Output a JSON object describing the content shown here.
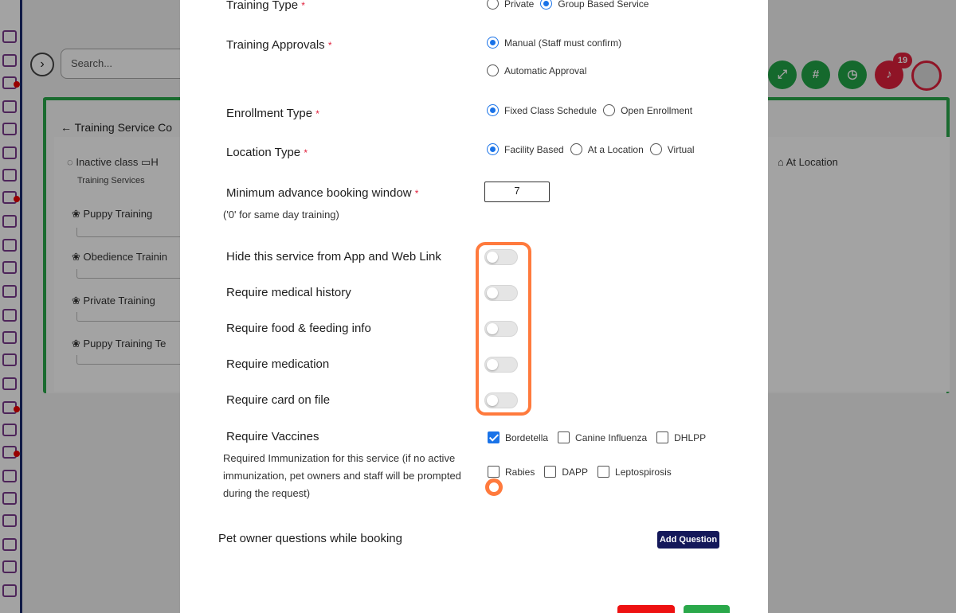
{
  "background": {
    "search_placeholder": "Search...",
    "breadcrumb": "← Training Service Co",
    "filter_inactive": "Inactive class",
    "filter_h": "H",
    "filter_at_location": "At Location",
    "services_header": "Training Services",
    "services": [
      "Puppy Training",
      "Obedience Trainin",
      "Private Training",
      "Puppy Training Te"
    ],
    "notification_count": "19",
    "top_icons": [
      "expand-icon",
      "hash-icon",
      "clock-icon",
      "bell-icon"
    ]
  },
  "form": {
    "training_type": {
      "label": "Training Type",
      "required": "*",
      "options": [
        {
          "label": "Private",
          "selected": false
        },
        {
          "label": "Group Based Service",
          "selected": true
        }
      ]
    },
    "training_approvals": {
      "label": "Training Approvals",
      "required": "*",
      "options": [
        {
          "label": "Manual (Staff must confirm)",
          "selected": true
        },
        {
          "label": "Automatic Approval",
          "selected": false
        }
      ]
    },
    "enrollment_type": {
      "label": "Enrollment Type",
      "required": "*",
      "options": [
        {
          "label": "Fixed Class Schedule",
          "selected": true
        },
        {
          "label": "Open Enrollment",
          "selected": false
        }
      ]
    },
    "location_type": {
      "label": "Location Type",
      "required": "*",
      "options": [
        {
          "label": "Facility Based",
          "selected": true
        },
        {
          "label": "At a Location",
          "selected": false
        },
        {
          "label": "Virtual",
          "selected": false
        }
      ]
    },
    "booking_window": {
      "label": "Minimum advance booking window",
      "required": "*",
      "hint": "('0' for same day training)",
      "value": "7"
    },
    "toggles": [
      {
        "label": "Hide this service from App and Web Link",
        "on": false
      },
      {
        "label": "Require medical history",
        "on": false
      },
      {
        "label": "Require food & feeding info",
        "on": false
      },
      {
        "label": "Require medication",
        "on": false
      },
      {
        "label": "Require card on file",
        "on": false
      }
    ],
    "vaccines": {
      "label": "Require Vaccines",
      "hint": "Required Immunization for this service (if no active immunization, pet owners and staff will be prompted during the request)",
      "options": [
        {
          "label": "Bordetella",
          "checked": true
        },
        {
          "label": "Canine Influenza",
          "checked": false
        },
        {
          "label": "DHLPP",
          "checked": false
        },
        {
          "label": "Rabies",
          "checked": false
        },
        {
          "label": "DAPP",
          "checked": false
        },
        {
          "label": "Leptospirosis",
          "checked": false
        }
      ]
    },
    "questions": {
      "label": "Pet owner questions while booking",
      "add_button": "Add Question"
    }
  },
  "colors": {
    "accent_blue": "#1a73e8",
    "required_red": "#e0203c",
    "highlight_orange": "#ff7a3d",
    "brand_green": "#2aa84a",
    "navy_button": "#14185a"
  }
}
